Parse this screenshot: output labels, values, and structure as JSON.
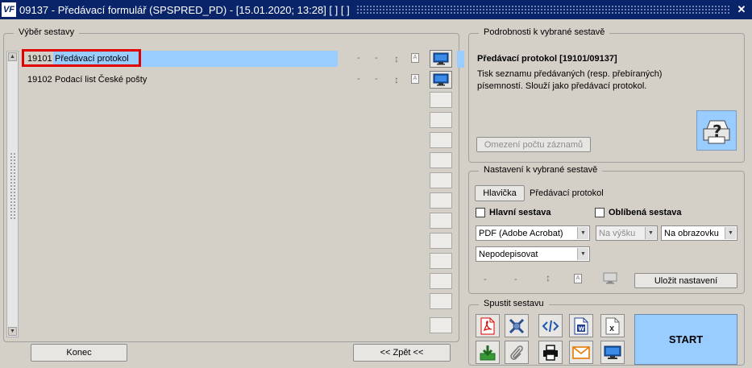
{
  "window": {
    "title": "09137 - Předávací formulář (SPSPRED_PD) - [15.01.2020; 13:28]  [ ]  [ ]",
    "logo": "VF",
    "close": "✕"
  },
  "left_panel": {
    "legend": "Výběr sestavy",
    "reports": [
      {
        "code": "19101",
        "name": "Předávací protokol",
        "selected": true
      },
      {
        "code": "19102",
        "name": "Podací list České pošty",
        "selected": false
      }
    ],
    "dash": "-",
    "konec_button": "Konec",
    "zpet_button": "<< Zpět <<"
  },
  "details": {
    "legend": "Podrobnosti k vybrané sestavě",
    "heading": "Předávací protokol [19101/09137]",
    "description_line1": "Tisk seznamu předávaných (resp. přebíraných)",
    "description_line2": "písemností. Slouží jako předávací protokol.",
    "limit_button": "Omezení počtu záznamů"
  },
  "settings": {
    "legend": "Nastavení k vybrané sestavě",
    "header_button": "Hlavička",
    "header_value": "Předávací protokol",
    "main_report_label": "Hlavní sestava",
    "favorite_label": "Oblíbená sestava",
    "format_value": "PDF (Adobe Acrobat)",
    "orientation_value": "Na výšku",
    "output_value": "Na obrazovku",
    "signature_value": "Nepodepisovat",
    "dash": "-",
    "save_button": "Uložit nastavení"
  },
  "run": {
    "legend": "Spustit sestavu",
    "start_button": "START"
  },
  "colors": {
    "selection": "#99ccff",
    "titlebar": "#0a246a",
    "highlight_border": "#e00000"
  }
}
